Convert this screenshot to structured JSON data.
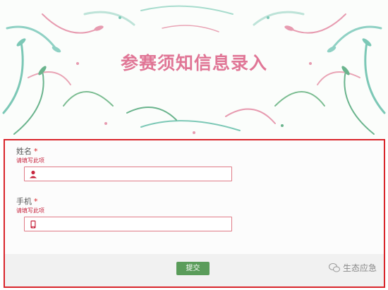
{
  "banner": {
    "title": "参赛须知信息录入"
  },
  "form": {
    "fields": [
      {
        "label": "姓名",
        "required": "*",
        "error": "请填写此项",
        "icon": "user-icon",
        "value": ""
      },
      {
        "label": "手机",
        "required": "*",
        "error": "请填写此项",
        "icon": "mobile-icon",
        "value": ""
      }
    ],
    "submit_label": "提交"
  },
  "watermark": {
    "text": "生态应急",
    "icon": "wechat-icon"
  },
  "colors": {
    "accent_red": "#d9252b",
    "title_pink": "#e07696",
    "button_green": "#5a9c5a"
  }
}
